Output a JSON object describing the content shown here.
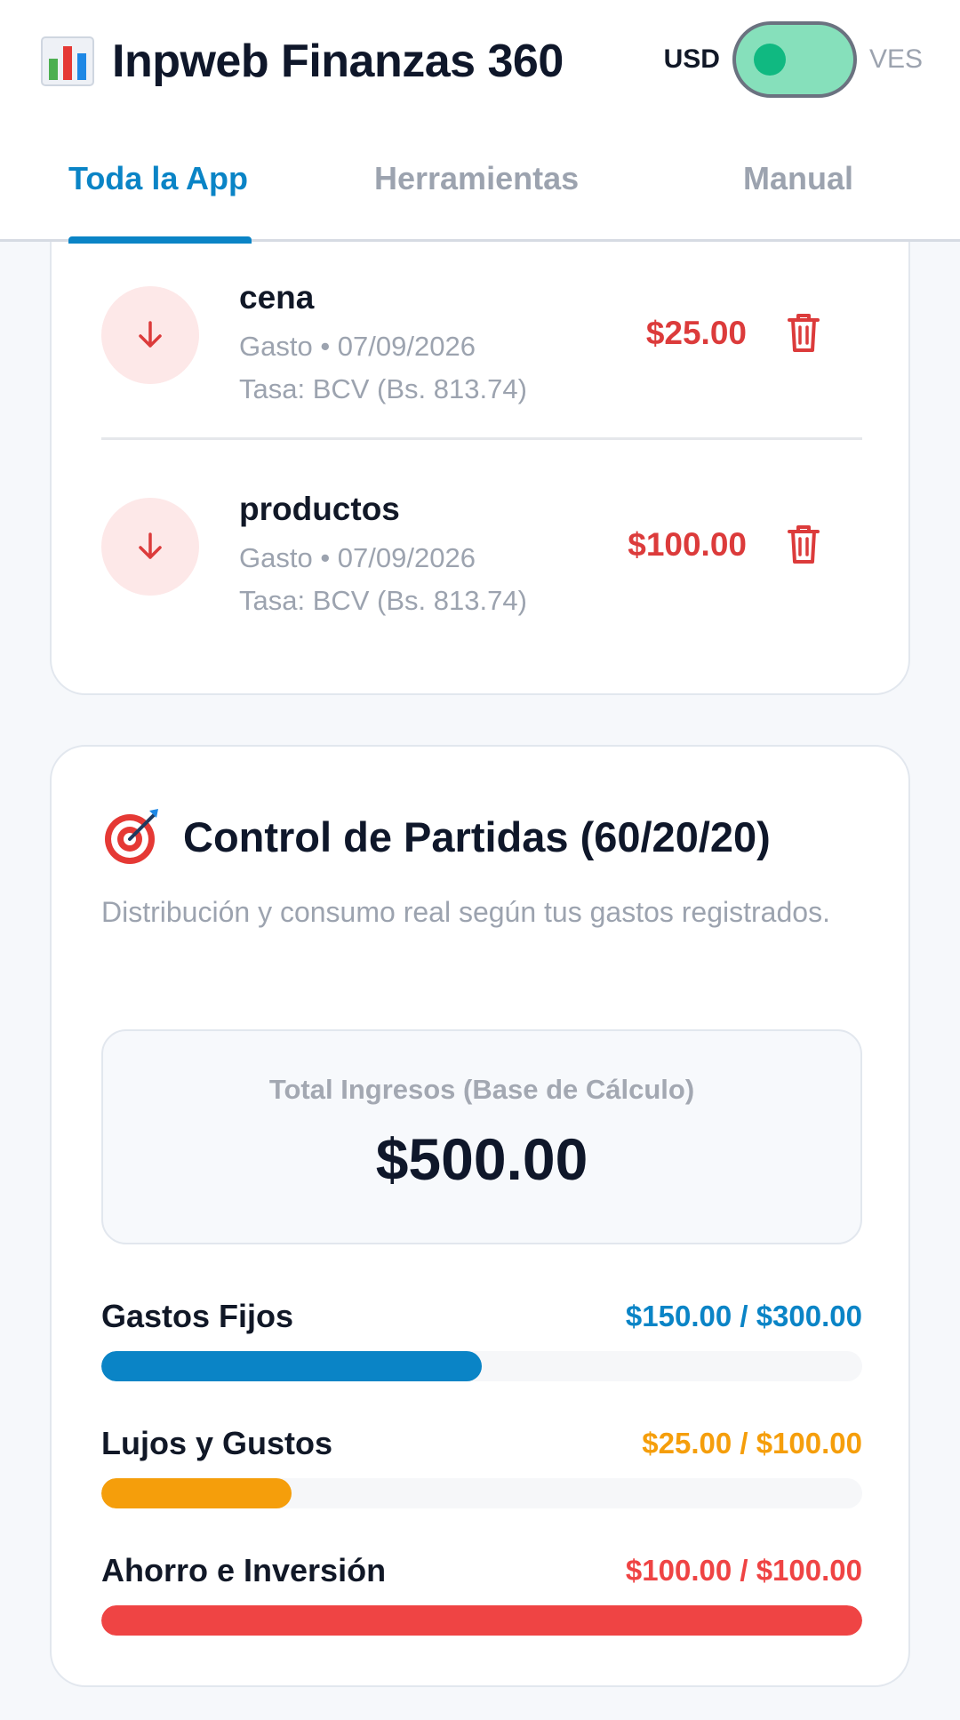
{
  "header": {
    "title": "Inpweb Finanzas 360",
    "currency_left": "USD",
    "currency_right": "VES",
    "toggle_on": true
  },
  "tabs": [
    {
      "label": "Toda la App",
      "active": true
    },
    {
      "label": "Herramientas",
      "active": false
    },
    {
      "label": "Manual",
      "active": false
    }
  ],
  "transactions": [
    {
      "name": "cena",
      "meta": "Gasto • 07/09/2026",
      "rate": "Tasa: BCV (Bs. 813.74)",
      "amount": "$25.00"
    },
    {
      "name": "productos",
      "meta": "Gasto • 07/09/2026",
      "rate": "Tasa: BCV (Bs. 813.74)",
      "amount": "$100.00"
    }
  ],
  "budget": {
    "title": "Control de Partidas (60/20/20)",
    "subtitle": "Distribución y consumo real según tus gastos registrados.",
    "total_label": "Total Ingresos (Base de Cálculo)",
    "total_value": "$500.00",
    "items": [
      {
        "label": "Gastos Fijos",
        "value": "$150.00 / $300.00",
        "fraction": 0.5,
        "color": "#0a84c6"
      },
      {
        "label": "Lujos y Gustos",
        "value": "$25.00 / $100.00",
        "fraction": 0.25,
        "color": "#f59e0b"
      },
      {
        "label": "Ahorro e Inversión",
        "value": "$100.00 / $100.00",
        "fraction": 1.0,
        "color": "#ef4444"
      }
    ]
  },
  "colors": {
    "accent": "#0a84c6",
    "expense": "#dc3b3b",
    "toggle_bg": "#86e0bb",
    "toggle_knob": "#10b981"
  },
  "icons": {
    "brand": "bar-chart-icon",
    "expense": "arrow-down-icon",
    "delete": "trash-icon",
    "budget": "target-icon"
  }
}
